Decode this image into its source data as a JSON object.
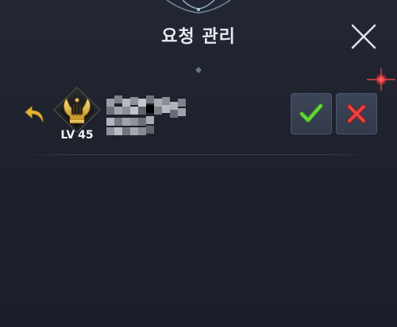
{
  "header": {
    "title": "요청 관리",
    "close_icon": "close-icon"
  },
  "request": {
    "level_prefix": "LV",
    "level": "45",
    "name": "",
    "reply_icon": "reply-arrow-icon",
    "emblem_icon": "lyre-emblem-icon",
    "accept_icon": "check-icon",
    "reject_icon": "x-icon"
  },
  "colors": {
    "background": "#1d212c",
    "accent_gold": "#d9b44a",
    "accept_green": "#5cc83a",
    "reject_red": "#e03a3a",
    "button_bg": "#384154",
    "sparkle_red": "#ff3a3a"
  }
}
